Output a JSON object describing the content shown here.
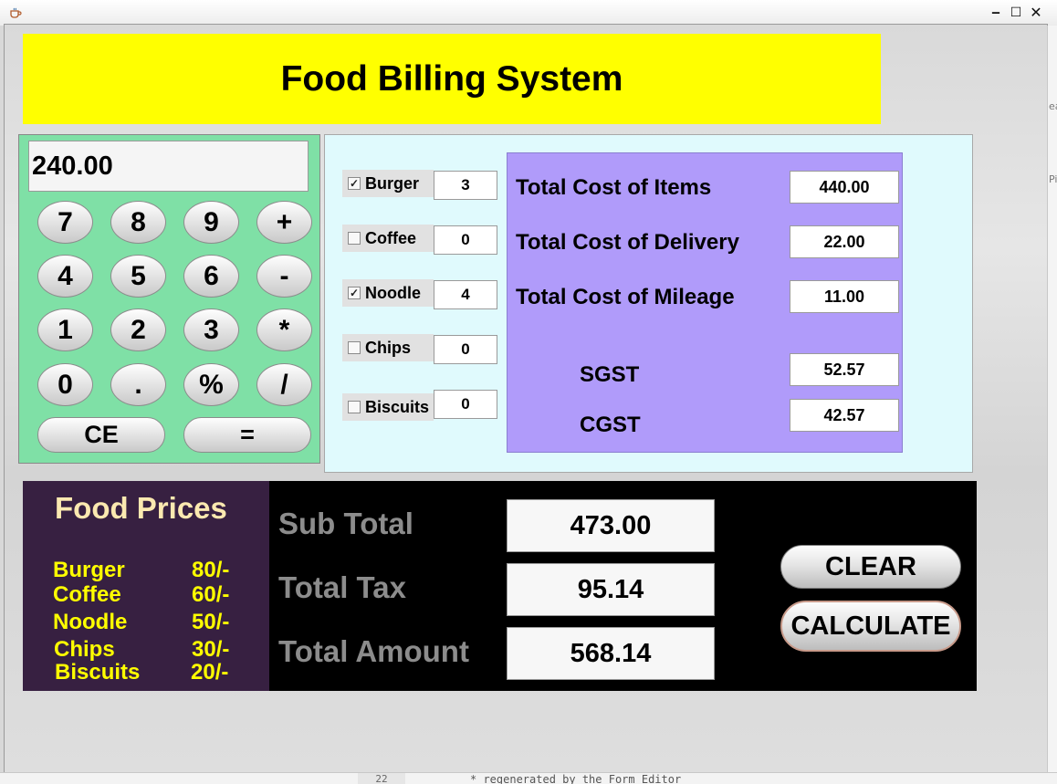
{
  "window": {
    "title": "",
    "controls": {
      "minimize": "‒",
      "maximize": "☐",
      "close": "✕"
    }
  },
  "header": {
    "title": "Food Billing System"
  },
  "calculator": {
    "display": "240.00",
    "keys": [
      "7",
      "8",
      "9",
      "+",
      "4",
      "5",
      "6",
      "-",
      "1",
      "2",
      "3",
      "*",
      "0",
      ".",
      "%",
      "/",
      "CE",
      "="
    ]
  },
  "items": [
    {
      "label": "Burger",
      "checked": true,
      "quantity": "3"
    },
    {
      "label": "Coffee",
      "checked": false,
      "quantity": "0"
    },
    {
      "label": "Noodle",
      "checked": true,
      "quantity": "4"
    },
    {
      "label": "Chips",
      "checked": false,
      "quantity": "0"
    },
    {
      "label": "Biscuits",
      "checked": false,
      "quantity": "0"
    }
  ],
  "costs": {
    "items_label": "Total Cost of Items",
    "items_value": "440.00",
    "delivery_label": "Total Cost of Delivery",
    "delivery_value": "22.00",
    "mileage_label": "Total Cost of Mileage",
    "mileage_value": "11.00",
    "sgst_label": "SGST",
    "sgst_value": "52.57",
    "cgst_label": "CGST",
    "cgst_value": "42.57"
  },
  "prices": {
    "title": "Food Prices",
    "list": [
      {
        "name": "Burger",
        "price": "80/-"
      },
      {
        "name": "Coffee",
        "price": "60/-"
      },
      {
        "name": "Noodle",
        "price": "50/-"
      },
      {
        "name": "Chips",
        "price": "30/-"
      },
      {
        "name": "Biscuits",
        "price": "20/-"
      }
    ]
  },
  "totals": {
    "subtotal_label": "Sub Total",
    "subtotal_value": "473.00",
    "tax_label": "Total Tax",
    "tax_value": "95.14",
    "amount_label": "Total Amount",
    "amount_value": "568.14"
  },
  "buttons": {
    "clear": "CLEAR",
    "calculate": "CALCULATE"
  },
  "background": {
    "right_strip_texts": [
      "ea",
      "Pi"
    ],
    "bottom_line_number": "22",
    "bottom_code": "* regenerated by the Form Editor"
  },
  "colors": {
    "header_bg": "#ffff00",
    "calc_bg": "#7fe0a6",
    "items_bg": "#e0fafd",
    "cost_bg": "#b09bfa",
    "prices_bg": "#372041",
    "prices_text": "#ffff00",
    "totals_bg": "#000000"
  }
}
